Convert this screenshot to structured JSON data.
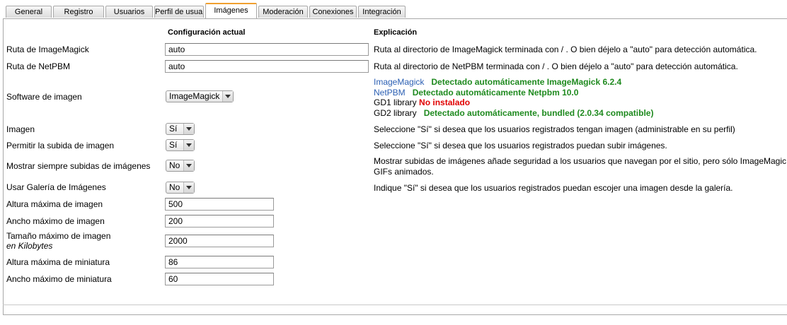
{
  "tabs": [
    "General",
    "Registro",
    "Usuarios",
    "Perfil de usuario",
    "Imágenes",
    "Moderación",
    "Conexiones",
    "Integración"
  ],
  "active_tab": "Imágenes",
  "headers": {
    "current": "Configuración actual",
    "explanation": "Explicación"
  },
  "imagemagick_path": {
    "label": "Ruta de ImageMagick",
    "value": "auto",
    "explanation": "Ruta al directorio de ImageMagick terminada con / . O bien déjelo a \"auto\" para detección automática."
  },
  "netpbm_path": {
    "label": "Ruta de NetPBM",
    "value": "auto",
    "explanation": "Ruta al directorio de NetPBM terminada con / . O bien déjelo a \"auto\" para detección automática."
  },
  "image_software": {
    "label": "Software de imagen",
    "value": "ImageMagick",
    "status": {
      "imagemagick_name": "ImageMagick",
      "imagemagick_status": "Detectado automáticamente ImageMagick 6.2.4",
      "netpbm_name": "NetPBM",
      "netpbm_status": "Detectado automáticamente Netpbm 10.0",
      "gd1_name": "GD1 library",
      "gd1_status": "No instalado",
      "gd2_name": "GD2 library",
      "gd2_status": "Detectado automáticamente, bundled (2.0.34 compatible)"
    }
  },
  "avatar": {
    "label": "Imagen",
    "value": "Sí",
    "explanation": "Seleccione \"Sí\" si desea que los usuarios registrados tengan imagen (administrable en su perfil)"
  },
  "allow_upload": {
    "label": "Permitir la subida de imagen",
    "value": "Sí",
    "explanation": "Seleccione \"Sí\" si desea que los usuarios registrados puedan subir imágenes."
  },
  "always_upload": {
    "label": "Mostrar siempre subidas de imágenes",
    "value": "No",
    "explanation_line1": "Mostrar subidas de imágenes añade seguridad a los usuarios que navegan por el sitio, pero sólo ImageMagic",
    "explanation_line2": "GIFs animados."
  },
  "gallery": {
    "label": "Usar Galería de Imágenes",
    "value": "No",
    "explanation": "Indique \"Sí\" si desea que los usuarios registrados puedan escojer una imagen desde la galería."
  },
  "max_height": {
    "label": "Altura máxima de imagen",
    "value": "500"
  },
  "max_width": {
    "label": "Ancho máximo de imagen",
    "value": "200"
  },
  "max_size": {
    "label_line1": "Tamaño máximo de imagen",
    "label_line2": "en Kilobytes",
    "value": "2000"
  },
  "thumb_height": {
    "label": "Altura máxima de miniatura",
    "value": "86"
  },
  "thumb_width": {
    "label": "Ancho máximo de miniatura",
    "value": "60"
  }
}
